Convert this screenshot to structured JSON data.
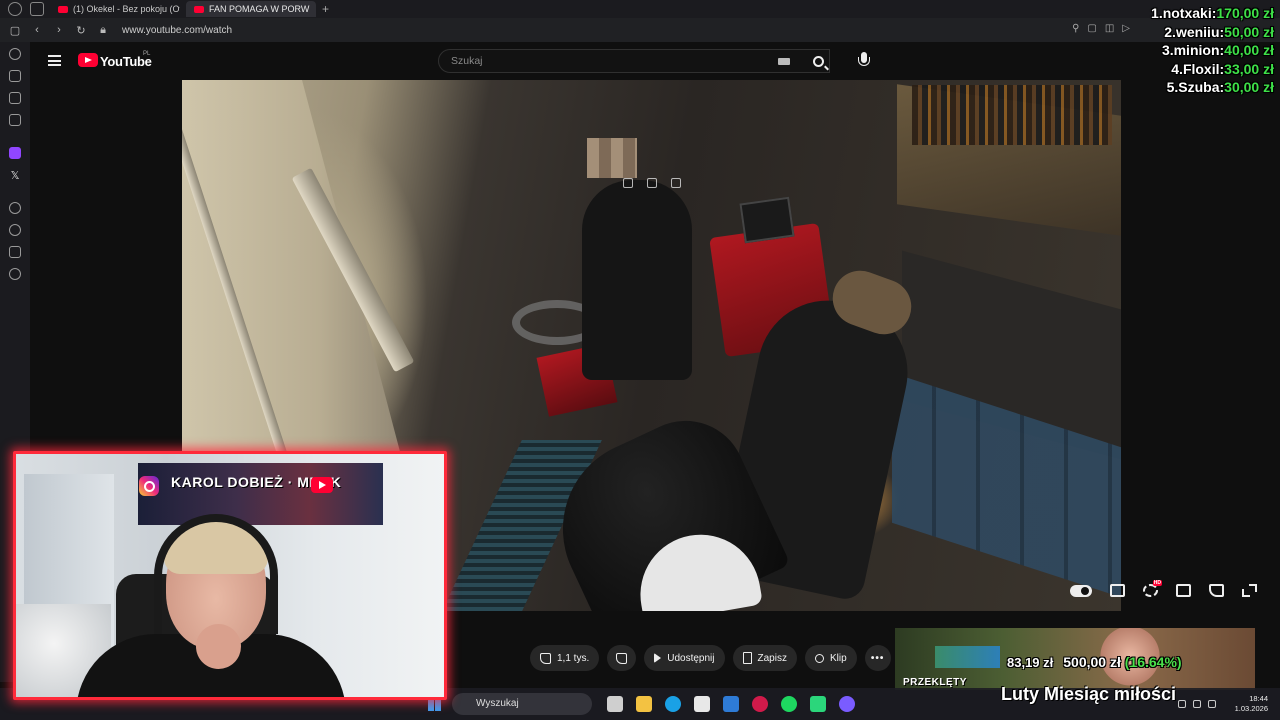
{
  "browser": {
    "tabs": [
      {
        "label": "(1) Okekel - Bez pokoju (Of",
        "active": false
      },
      {
        "label": "FAN POMAGA W PORW",
        "active": true
      }
    ],
    "url": "www.youtube.com/watch"
  },
  "youtube": {
    "logo_text": "YouTube",
    "country_code": "PL",
    "search_placeholder": "Szukaj",
    "actions": {
      "like_count": "1,1 tys.",
      "share_label": "Udostępnij",
      "save_label": "Zapisz",
      "clip_label": "Klip",
      "more_label": "•••"
    },
    "player_controls": [
      "autoplay-toggle",
      "subtitles-icon",
      "settings-gear-icon",
      "miniplayer-icon",
      "cast-icon",
      "fullscreen-icon"
    ],
    "hd_badge": "HD"
  },
  "donations": [
    {
      "name": "1.notxaki:",
      "amount": "170,00 zł"
    },
    {
      "name": "2.weniiu:",
      "amount": "50,00 zł"
    },
    {
      "name": "3.minion:",
      "amount": "40,00 zł"
    },
    {
      "name": "4.Floxil:",
      "amount": "33,00 zł"
    },
    {
      "name": "5.Szuba:",
      "amount": "30,00 zł"
    }
  ],
  "webcam": {
    "banner_text": "KAROL DOBIEŻ · MRDK"
  },
  "goal": {
    "current": "83,19 zł",
    "target": "500,00 zł",
    "percent": "(16.64%)",
    "title": "Luty Miesiąc miłości",
    "promo_label": "PRZEKLĘTY"
  },
  "taskbar": {
    "search_label": "Wyszukaj",
    "time": "18:44",
    "date": "1.03.2026"
  },
  "colors": {
    "youtube_red": "#ff0033",
    "donation_amount": "#3ee048",
    "webcam_border": "#ff2a3a"
  }
}
